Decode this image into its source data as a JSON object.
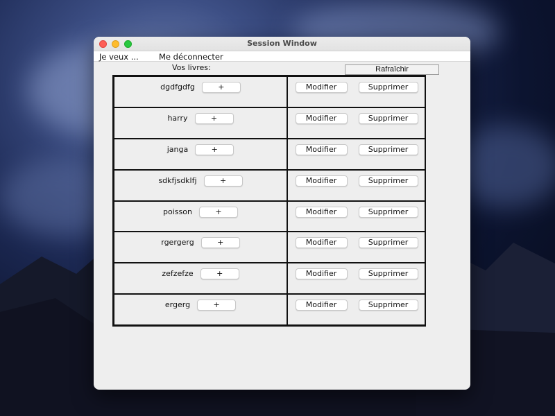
{
  "window": {
    "title": "Session Window"
  },
  "menu": {
    "items": [
      "Je veux ...",
      "Me déconnecter"
    ]
  },
  "header": {
    "label": "Vos livres:",
    "refresh_label": "Rafraîchir"
  },
  "books": [
    {
      "title": "dgdfgdfg",
      "add_label": "+",
      "edit_label": "Modifier",
      "delete_label": "Supprimer"
    },
    {
      "title": "harry",
      "add_label": "+",
      "edit_label": "Modifier",
      "delete_label": "Supprimer"
    },
    {
      "title": "janga",
      "add_label": "+",
      "edit_label": "Modifier",
      "delete_label": "Supprimer"
    },
    {
      "title": "sdkfjsdklfj",
      "add_label": "+",
      "edit_label": "Modifier",
      "delete_label": "Supprimer"
    },
    {
      "title": "poisson",
      "add_label": "+",
      "edit_label": "Modifier",
      "delete_label": "Supprimer"
    },
    {
      "title": "rgergerg",
      "add_label": "+",
      "edit_label": "Modifier",
      "delete_label": "Supprimer"
    },
    {
      "title": "zefzefze",
      "add_label": "+",
      "edit_label": "Modifier",
      "delete_label": "Supprimer"
    },
    {
      "title": "ergerg",
      "add_label": "+",
      "edit_label": "Modifier",
      "delete_label": "Supprimer"
    }
  ],
  "colors": {
    "close": "#fe5f57",
    "minimize": "#febc2e",
    "maximize": "#28c840",
    "window_bg": "#eeeeee"
  }
}
